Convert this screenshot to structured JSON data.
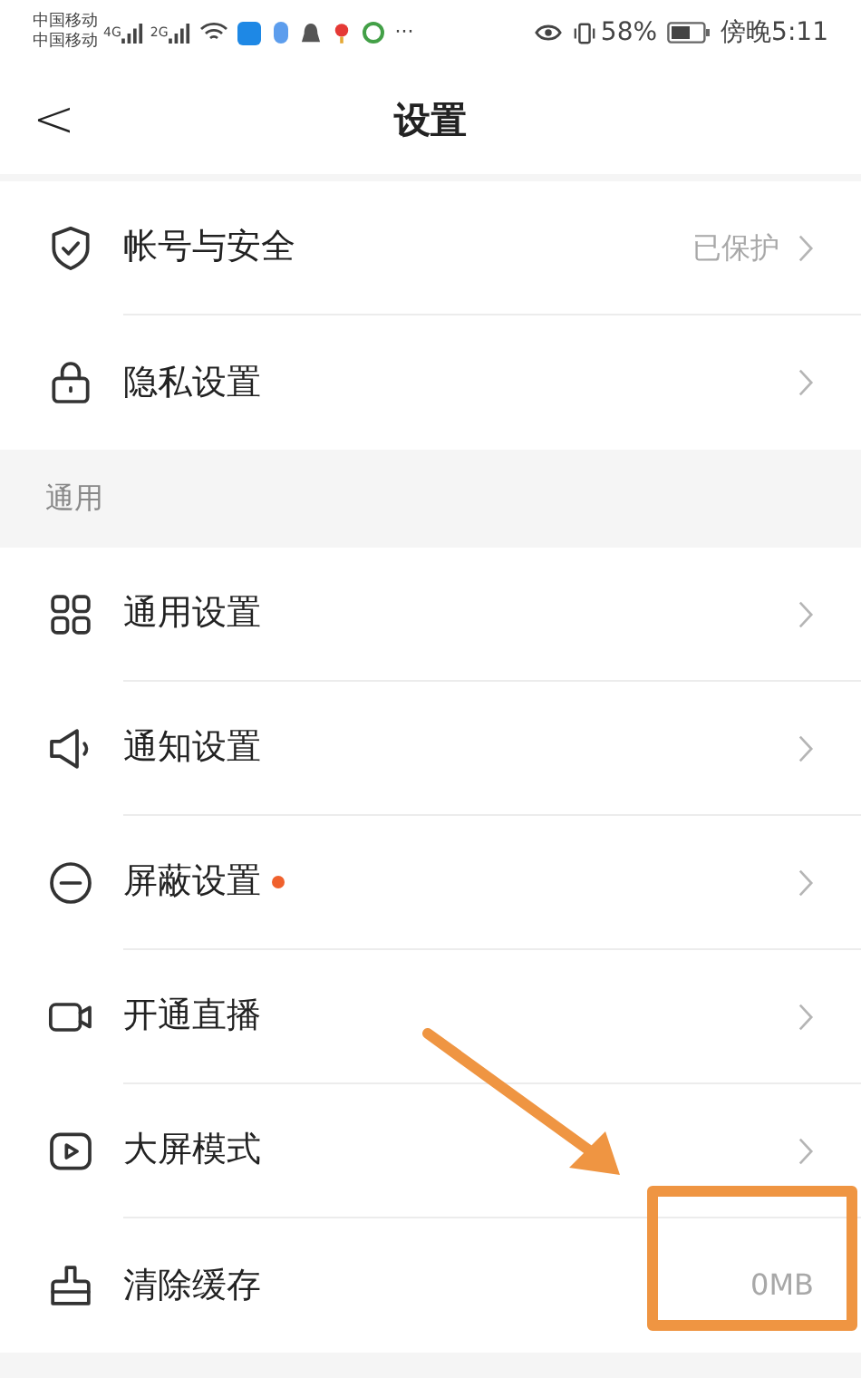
{
  "status_bar": {
    "carriers": [
      "中国移动",
      "中国移动"
    ],
    "networks": [
      "4G",
      "2G"
    ],
    "more": "···",
    "battery": "58%",
    "time": "傍晚5:11"
  },
  "header": {
    "back": "<",
    "title": "设置"
  },
  "sections": [
    {
      "rows": [
        {
          "label": "帐号与安全",
          "value": "已保护",
          "chevron": true,
          "dot": false,
          "highlighted": false
        },
        {
          "label": "隐私设置",
          "chevron": true,
          "dot": false,
          "highlighted": false
        }
      ]
    },
    {
      "title": "通用",
      "rows": [
        {
          "label": "通用设置",
          "chevron": true,
          "dot": false,
          "highlighted": false
        },
        {
          "label": "通知设置",
          "chevron": true,
          "dot": false,
          "highlighted": false
        },
        {
          "label": "屏蔽设置",
          "chevron": true,
          "dot": true,
          "highlighted": false
        },
        {
          "label": "开通直播",
          "chevron": true,
          "dot": false,
          "highlighted": false
        },
        {
          "label": "大屏模式",
          "chevron": true,
          "dot": false,
          "highlighted": false
        },
        {
          "label": "清除缓存",
          "value": "0MB",
          "chevron": false,
          "dot": false,
          "highlighted": true
        }
      ]
    }
  ]
}
